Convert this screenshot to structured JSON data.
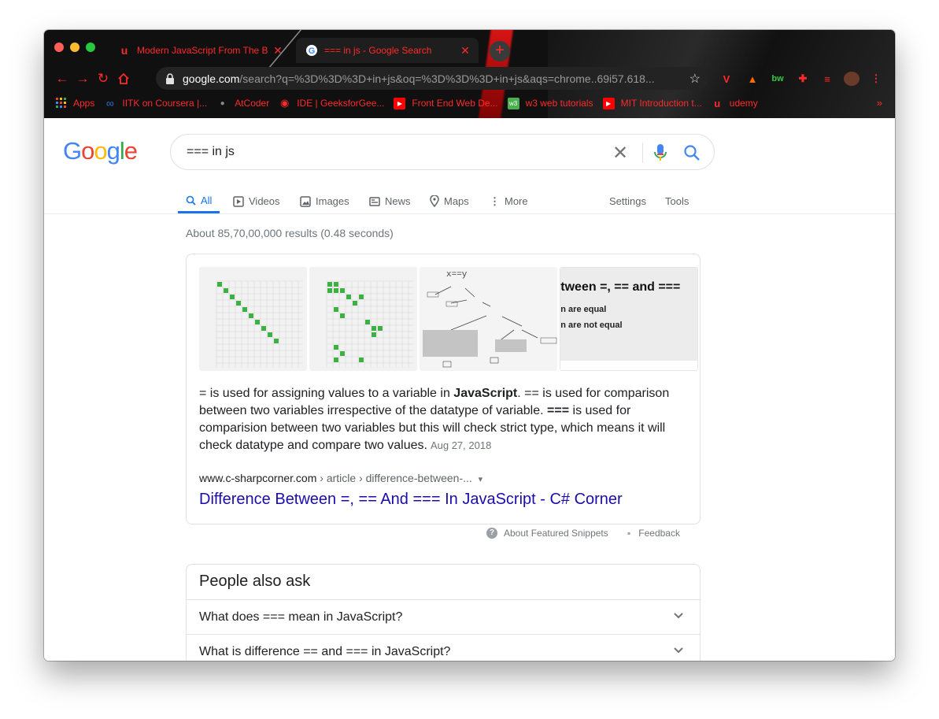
{
  "browser": {
    "tabs": [
      {
        "title": "Modern JavaScript From The B",
        "close": "✕",
        "icon": "udemy-icon"
      },
      {
        "title": "=== in js - Google Search",
        "close": "✕",
        "icon": "google-icon"
      }
    ],
    "new_tab": "+",
    "url_host": "google.com",
    "url_rest": "/search?q=%3D%3D%3D+in+js&oq=%3D%3D%3D+in+js&aqs=chrome..69i57.618...",
    "bookmarks": [
      {
        "label": "Apps",
        "icon": "apps-grid-icon"
      },
      {
        "label": "IITK on Coursera |...",
        "icon": "coursera-icon"
      },
      {
        "label": "AtCoder",
        "icon": "atcoder-icon"
      },
      {
        "label": "IDE | GeeksforGee...",
        "icon": "gfg-icon"
      },
      {
        "label": "Front End Web De...",
        "icon": "youtube-icon"
      },
      {
        "label": "w3 web tutorials",
        "icon": "w3-icon"
      },
      {
        "label": "MIT Introduction t...",
        "icon": "youtube-icon"
      },
      {
        "label": "udemy",
        "icon": "udemy-icon"
      }
    ],
    "bookmarks_more": "»",
    "accent": "#ff2a2a"
  },
  "search": {
    "logo": "Google",
    "query": "=== in js",
    "tabs": [
      {
        "label": "All",
        "icon": "search-icon",
        "active": true
      },
      {
        "label": "Videos",
        "icon": "video-icon"
      },
      {
        "label": "Images",
        "icon": "image-icon"
      },
      {
        "label": "News",
        "icon": "news-icon"
      },
      {
        "label": "Maps",
        "icon": "map-pin-icon"
      },
      {
        "label": "More",
        "icon": "more-vert-icon"
      }
    ],
    "settings": "Settings",
    "tools": "Tools",
    "stats": "About 85,70,00,000 results (0.48 seconds)"
  },
  "snippet": {
    "thumb3_title": "x==y",
    "thumb4_title": "tween =, == and ===",
    "thumb4_line1": "n are equal",
    "thumb4_line2": "n are not equal",
    "text_parts": [
      "= is used for assigning values to a variable in ",
      "JavaScript",
      ". == is used for comparison between two variables irrespective of the datatype of variable. ",
      "===",
      " is used for comparision between two variables but this will check strict type, which means it will check datatype and compare two values."
    ],
    "date": "Aug 27, 2018",
    "cite_host": "www.c-sharpcorner.com",
    "cite_path": " › article › difference-between-...",
    "cite_arrow": "▾",
    "link": "Difference Between =, == And === In JavaScript - C# Corner",
    "about": "About Featured Snippets",
    "feedback": "Feedback"
  },
  "paa": {
    "title": "People also ask",
    "questions": [
      "What does === mean in JavaScript?",
      "What is difference == and === in JavaScript?"
    ]
  }
}
